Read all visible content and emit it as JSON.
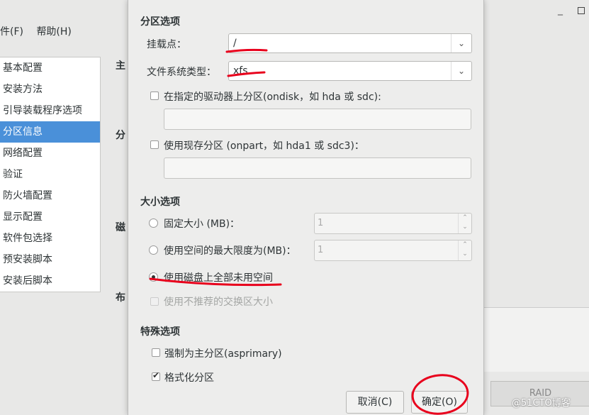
{
  "background": {
    "menu": [
      "件(F)",
      "帮助(H)"
    ],
    "sidebar": [
      "基本配置",
      "安装方法",
      "引导装载程序选项",
      "分区信息",
      "网络配置",
      "验证",
      "防火墙配置",
      "显示配置",
      "软件包选择",
      "预安装脚本",
      "安装后脚本"
    ],
    "sidebar_active_index": 3,
    "headings": [
      "主",
      "分",
      "磁",
      "布"
    ],
    "raid_label": "RAID",
    "watermark": "@51CTO博客"
  },
  "dialog": {
    "partition_options_title": "分区选项",
    "mount_point_label": "挂载点：",
    "mount_point_value": "/",
    "fs_type_label": "文件系统类型：",
    "fs_type_value": "xfs",
    "ondisk_label": "在指定的驱动器上分区(ondisk，如 hda 或 sdc):",
    "ondisk_checked": false,
    "onpart_label": "使用现存分区 (onpart，如 hda1 或 sdc3)：",
    "onpart_checked": false,
    "size_options_title": "大小选项",
    "fixed_size_label": "固定大小 (MB)：",
    "fixed_size_value": "1",
    "max_size_label": "使用空间的最大限度为(MB)：",
    "max_size_value": "1",
    "fill_disk_label": "使用磁盘上全部未用空间",
    "selected_size_option": "fill_disk",
    "recommended_swap_label": "使用不推荐的交换区大小",
    "special_options_title": "特殊选项",
    "asprimary_label": "强制为主分区(asprimary)",
    "asprimary_checked": false,
    "format_label": "格式化分区",
    "format_checked": true,
    "cancel_label": "取消(C)",
    "ok_label": "确定(O)"
  },
  "colors": {
    "accent": "#4a90d9",
    "annotation": "#e8001c"
  }
}
